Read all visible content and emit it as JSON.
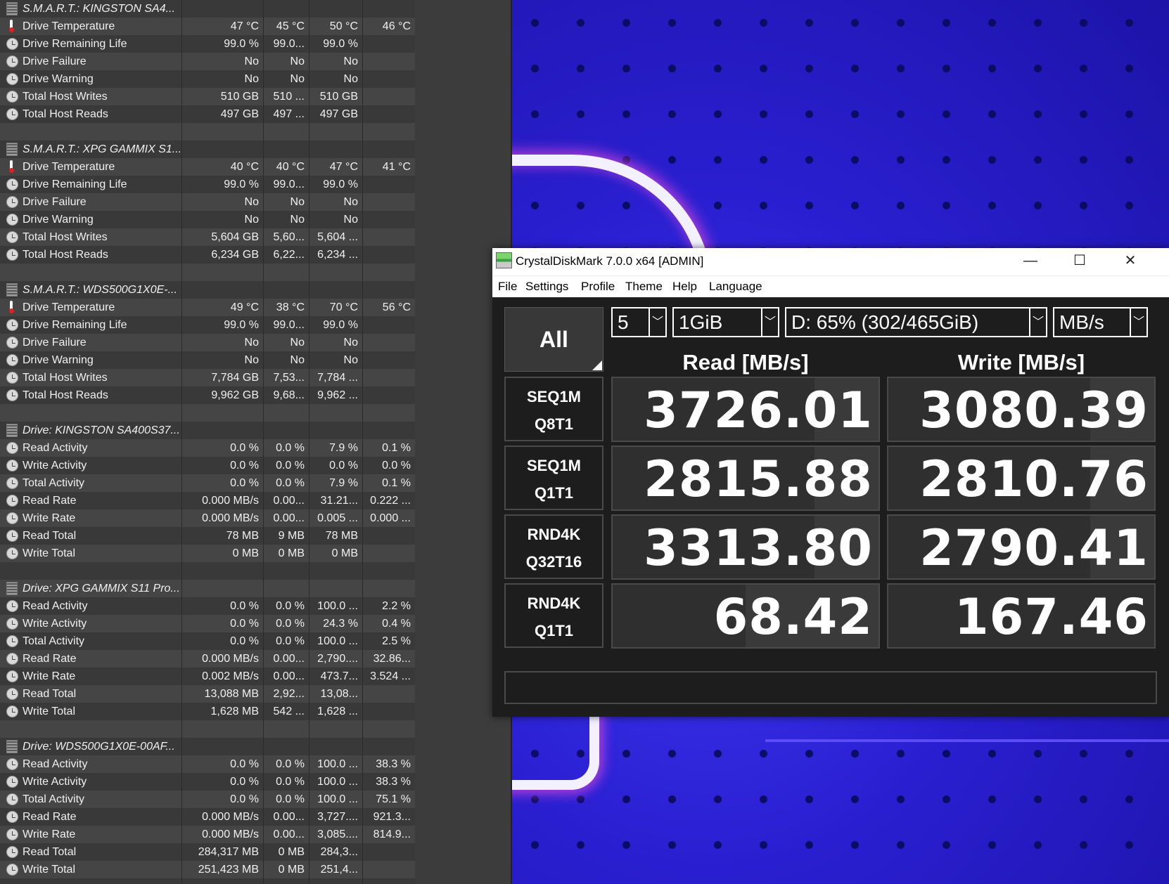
{
  "hwinfo": {
    "rows": [
      {
        "type": "header",
        "icon": "disk",
        "label": "S.M.A.R.T.: KINGSTON SA4...",
        "v": [
          "",
          "",
          "",
          ""
        ]
      },
      {
        "type": "sensor",
        "icon": "therm",
        "label": "Drive Temperature",
        "v": [
          "47 °C",
          "45 °C",
          "50 °C",
          "46 °C"
        ]
      },
      {
        "type": "sensor",
        "icon": "clock",
        "label": "Drive Remaining Life",
        "v": [
          "99.0 %",
          "99.0...",
          "99.0 %",
          ""
        ]
      },
      {
        "type": "sensor",
        "icon": "clock",
        "label": "Drive Failure",
        "v": [
          "No",
          "No",
          "No",
          ""
        ]
      },
      {
        "type": "sensor",
        "icon": "clock",
        "label": "Drive Warning",
        "v": [
          "No",
          "No",
          "No",
          ""
        ]
      },
      {
        "type": "sensor",
        "icon": "clock",
        "label": "Total Host Writes",
        "v": [
          "510 GB",
          "510 ...",
          "510 GB",
          ""
        ]
      },
      {
        "type": "sensor",
        "icon": "clock",
        "label": "Total Host Reads",
        "v": [
          "497 GB",
          "497 ...",
          "497 GB",
          ""
        ]
      },
      {
        "type": "blank",
        "icon": "",
        "label": "",
        "v": [
          "",
          "",
          "",
          ""
        ]
      },
      {
        "type": "header",
        "icon": "disk",
        "label": "S.M.A.R.T.: XPG GAMMIX S1...",
        "v": [
          "",
          "",
          "",
          ""
        ]
      },
      {
        "type": "sensor",
        "icon": "therm",
        "label": "Drive Temperature",
        "v": [
          "40 °C",
          "40 °C",
          "47 °C",
          "41 °C"
        ]
      },
      {
        "type": "sensor",
        "icon": "clock",
        "label": "Drive Remaining Life",
        "v": [
          "99.0 %",
          "99.0...",
          "99.0 %",
          ""
        ]
      },
      {
        "type": "sensor",
        "icon": "clock",
        "label": "Drive Failure",
        "v": [
          "No",
          "No",
          "No",
          ""
        ]
      },
      {
        "type": "sensor",
        "icon": "clock",
        "label": "Drive Warning",
        "v": [
          "No",
          "No",
          "No",
          ""
        ]
      },
      {
        "type": "sensor",
        "icon": "clock",
        "label": "Total Host Writes",
        "v": [
          "5,604 GB",
          "5,60...",
          "5,604 ...",
          ""
        ]
      },
      {
        "type": "sensor",
        "icon": "clock",
        "label": "Total Host Reads",
        "v": [
          "6,234 GB",
          "6,22...",
          "6,234 ...",
          ""
        ]
      },
      {
        "type": "blank",
        "icon": "",
        "label": "",
        "v": [
          "",
          "",
          "",
          ""
        ]
      },
      {
        "type": "header",
        "icon": "disk",
        "label": "S.M.A.R.T.: WDS500G1X0E-...",
        "v": [
          "",
          "",
          "",
          ""
        ]
      },
      {
        "type": "sensor",
        "icon": "therm",
        "label": "Drive Temperature",
        "v": [
          "49 °C",
          "38 °C",
          "70 °C",
          "56 °C"
        ]
      },
      {
        "type": "sensor",
        "icon": "clock",
        "label": "Drive Remaining Life",
        "v": [
          "99.0 %",
          "99.0...",
          "99.0 %",
          ""
        ]
      },
      {
        "type": "sensor",
        "icon": "clock",
        "label": "Drive Failure",
        "v": [
          "No",
          "No",
          "No",
          ""
        ]
      },
      {
        "type": "sensor",
        "icon": "clock",
        "label": "Drive Warning",
        "v": [
          "No",
          "No",
          "No",
          ""
        ]
      },
      {
        "type": "sensor",
        "icon": "clock",
        "label": "Total Host Writes",
        "v": [
          "7,784 GB",
          "7,53...",
          "7,784 ...",
          ""
        ]
      },
      {
        "type": "sensor",
        "icon": "clock",
        "label": "Total Host Reads",
        "v": [
          "9,962 GB",
          "9,68...",
          "9,962 ...",
          ""
        ]
      },
      {
        "type": "blank",
        "icon": "",
        "label": "",
        "v": [
          "",
          "",
          "",
          ""
        ]
      },
      {
        "type": "header",
        "icon": "disk",
        "label": "Drive: KINGSTON SA400S37...",
        "v": [
          "",
          "",
          "",
          ""
        ]
      },
      {
        "type": "sensor",
        "icon": "clock",
        "label": "Read Activity",
        "v": [
          "0.0 %",
          "0.0 %",
          "7.9 %",
          "0.1 %"
        ]
      },
      {
        "type": "sensor",
        "icon": "clock",
        "label": "Write Activity",
        "v": [
          "0.0 %",
          "0.0 %",
          "0.0 %",
          "0.0 %"
        ]
      },
      {
        "type": "sensor",
        "icon": "clock",
        "label": "Total Activity",
        "v": [
          "0.0 %",
          "0.0 %",
          "7.9 %",
          "0.1 %"
        ]
      },
      {
        "type": "sensor",
        "icon": "clock",
        "label": "Read Rate",
        "v": [
          "0.000 MB/s",
          "0.00...",
          "31.21...",
          "0.222 ..."
        ]
      },
      {
        "type": "sensor",
        "icon": "clock",
        "label": "Write Rate",
        "v": [
          "0.000 MB/s",
          "0.00...",
          "0.005 ...",
          "0.000 ..."
        ]
      },
      {
        "type": "sensor",
        "icon": "clock",
        "label": "Read Total",
        "v": [
          "78 MB",
          "9 MB",
          "78 MB",
          ""
        ]
      },
      {
        "type": "sensor",
        "icon": "clock",
        "label": "Write Total",
        "v": [
          "0 MB",
          "0 MB",
          "0 MB",
          ""
        ]
      },
      {
        "type": "blank",
        "icon": "",
        "label": "",
        "v": [
          "",
          "",
          "",
          ""
        ]
      },
      {
        "type": "header",
        "icon": "disk",
        "label": "Drive: XPG GAMMIX S11 Pro...",
        "v": [
          "",
          "",
          "",
          ""
        ]
      },
      {
        "type": "sensor",
        "icon": "clock",
        "label": "Read Activity",
        "v": [
          "0.0 %",
          "0.0 %",
          "100.0 ...",
          "2.2 %"
        ]
      },
      {
        "type": "sensor",
        "icon": "clock",
        "label": "Write Activity",
        "v": [
          "0.0 %",
          "0.0 %",
          "24.3 %",
          "0.4 %"
        ]
      },
      {
        "type": "sensor",
        "icon": "clock",
        "label": "Total Activity",
        "v": [
          "0.0 %",
          "0.0 %",
          "100.0 ...",
          "2.5 %"
        ]
      },
      {
        "type": "sensor",
        "icon": "clock",
        "label": "Read Rate",
        "v": [
          "0.000 MB/s",
          "0.00...",
          "2,790....",
          "32.86..."
        ]
      },
      {
        "type": "sensor",
        "icon": "clock",
        "label": "Write Rate",
        "v": [
          "0.002 MB/s",
          "0.00...",
          "473.7...",
          "3.524 ..."
        ]
      },
      {
        "type": "sensor",
        "icon": "clock",
        "label": "Read Total",
        "v": [
          "13,088 MB",
          "2,92...",
          "13,08...",
          ""
        ]
      },
      {
        "type": "sensor",
        "icon": "clock",
        "label": "Write Total",
        "v": [
          "1,628 MB",
          "542 ...",
          "1,628 ...",
          ""
        ]
      },
      {
        "type": "blank",
        "icon": "",
        "label": "",
        "v": [
          "",
          "",
          "",
          ""
        ]
      },
      {
        "type": "header",
        "icon": "disk",
        "label": "Drive: WDS500G1X0E-00AF...",
        "v": [
          "",
          "",
          "",
          ""
        ]
      },
      {
        "type": "sensor",
        "icon": "clock",
        "label": "Read Activity",
        "v": [
          "0.0 %",
          "0.0 %",
          "100.0 ...",
          "38.3 %"
        ]
      },
      {
        "type": "sensor",
        "icon": "clock",
        "label": "Write Activity",
        "v": [
          "0.0 %",
          "0.0 %",
          "100.0 ...",
          "38.3 %"
        ]
      },
      {
        "type": "sensor",
        "icon": "clock",
        "label": "Total Activity",
        "v": [
          "0.0 %",
          "0.0 %",
          "100.0 ...",
          "75.1 %"
        ]
      },
      {
        "type": "sensor",
        "icon": "clock",
        "label": "Read Rate",
        "v": [
          "0.000 MB/s",
          "0.00...",
          "3,727....",
          "921.3..."
        ]
      },
      {
        "type": "sensor",
        "icon": "clock",
        "label": "Write Rate",
        "v": [
          "0.000 MB/s",
          "0.00...",
          "3,085....",
          "814.9..."
        ]
      },
      {
        "type": "sensor",
        "icon": "clock",
        "label": "Read Total",
        "v": [
          "284,317 MB",
          "0 MB",
          "284,3...",
          ""
        ]
      },
      {
        "type": "sensor",
        "icon": "clock",
        "label": "Write Total",
        "v": [
          "251,423 MB",
          "0 MB",
          "251,4...",
          ""
        ]
      }
    ]
  },
  "cdm": {
    "title": "CrystalDiskMark 7.0.0 x64 [ADMIN]",
    "window_controls": {
      "minimize": "—",
      "maximize": "☐",
      "close": "✕"
    },
    "menu": [
      "File",
      "Settings",
      "Profile",
      "Theme",
      "Help",
      "Language"
    ],
    "all_label": "All",
    "count": "5",
    "size": "1GiB",
    "drive": "D: 65% (302/465GiB)",
    "unit": "MB/s",
    "read_header": "Read [MB/s]",
    "write_header": "Write [MB/s]",
    "tests": [
      {
        "line1": "SEQ1M",
        "line2": "Q8T1",
        "read": "3726.01",
        "write": "3080.39",
        "read_bar": 0.24,
        "write_bar": 0.24
      },
      {
        "line1": "SEQ1M",
        "line2": "Q1T1",
        "read": "2815.88",
        "write": "2810.76",
        "read_bar": 0.24,
        "write_bar": 0.24
      },
      {
        "line1": "RND4K",
        "line2": "Q32T16",
        "read": "3313.80",
        "write": "2790.41",
        "read_bar": 0.24,
        "write_bar": 0.24
      },
      {
        "line1": "RND4K",
        "line2": "Q1T1",
        "read": "68.42",
        "write": "167.46",
        "read_bar": 0.5,
        "write_bar": 0.0
      }
    ],
    "comment": ""
  }
}
